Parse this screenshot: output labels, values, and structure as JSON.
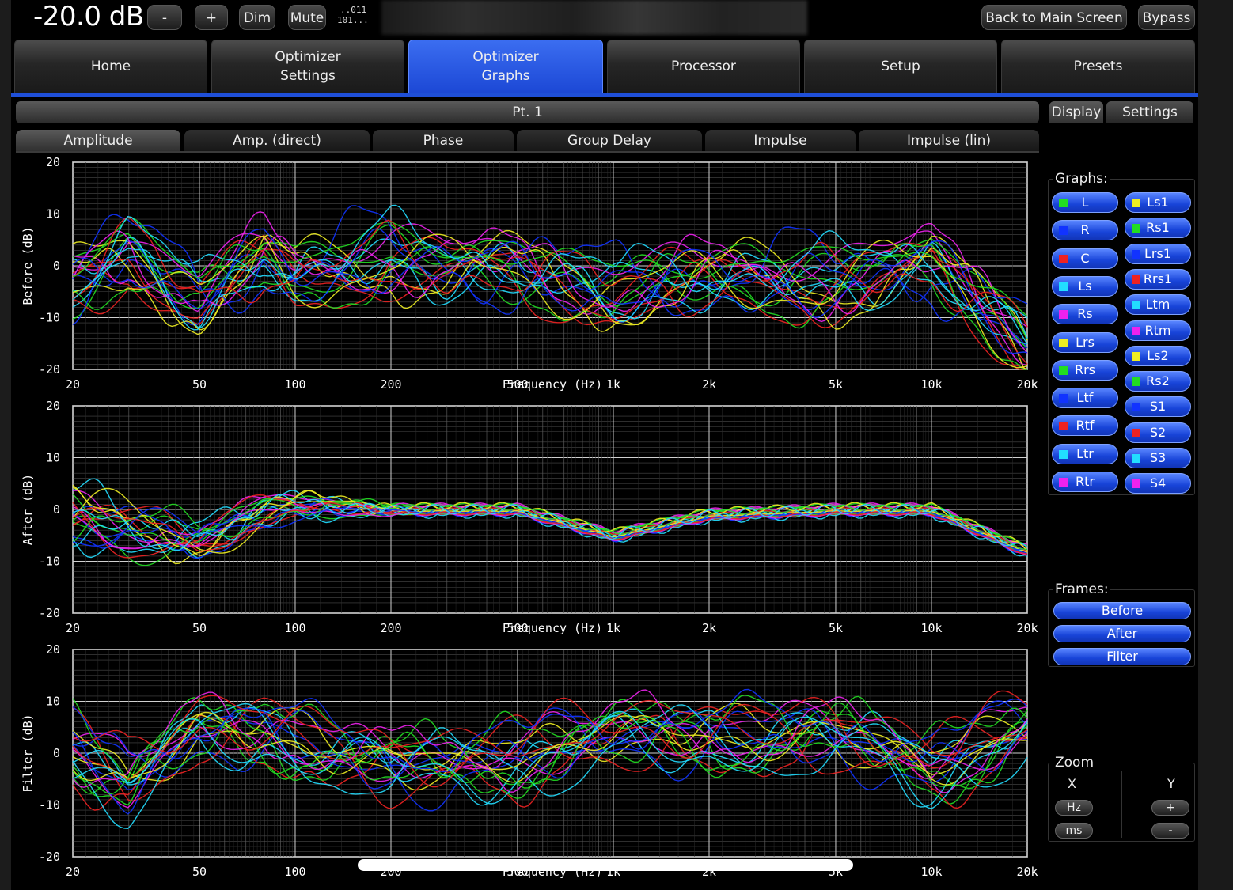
{
  "header": {
    "volume": "-20.0 dB",
    "minus_label": "-",
    "plus_label": "+",
    "dim_label": "Dim",
    "mute_label": "Mute",
    "meter_line1": "..011",
    "meter_line2": "101...",
    "back_label": "Back to Main Screen",
    "bypass_label": "Bypass"
  },
  "nav": {
    "home": "Home",
    "opt_settings_1": "Optimizer",
    "opt_settings_2": "Settings",
    "opt_graphs_1": "Optimizer",
    "opt_graphs_2": "Graphs",
    "processor": "Processor",
    "setup": "Setup",
    "presets": "Presets"
  },
  "point_label": "Pt. 1",
  "subtabs": [
    "Amplitude",
    "Amp. (direct)",
    "Phase",
    "Group Delay",
    "Impulse",
    "Impulse (lin)"
  ],
  "side_tabs": {
    "display": "Display",
    "settings": "Settings"
  },
  "graphs_panel": {
    "title": "Graphs:",
    "channels": [
      {
        "label": "L",
        "color": "#22dd22"
      },
      {
        "label": "R",
        "color": "#1133ff"
      },
      {
        "label": "C",
        "color": "#ee2222"
      },
      {
        "label": "Ls",
        "color": "#22ddff"
      },
      {
        "label": "Rs",
        "color": "#ee22ee"
      },
      {
        "label": "Lrs",
        "color": "#eeee22"
      },
      {
        "label": "Rrs",
        "color": "#22dd22"
      },
      {
        "label": "Ltf",
        "color": "#1133ff"
      },
      {
        "label": "Rtf",
        "color": "#ee2222"
      },
      {
        "label": "Ltr",
        "color": "#22ddff"
      },
      {
        "label": "Rtr",
        "color": "#ee22ee"
      },
      {
        "label": "Ls1",
        "color": "#eeee22"
      },
      {
        "label": "Rs1",
        "color": "#22dd22"
      },
      {
        "label": "Lrs1",
        "color": "#1133ff"
      },
      {
        "label": "Rrs1",
        "color": "#ee2222"
      },
      {
        "label": "Ltm",
        "color": "#22ddff"
      },
      {
        "label": "Rtm",
        "color": "#ee22ee"
      },
      {
        "label": "Ls2",
        "color": "#eeee22"
      },
      {
        "label": "Rs2",
        "color": "#22dd22"
      },
      {
        "label": "S1",
        "color": "#1133ff"
      },
      {
        "label": "S2",
        "color": "#ee2222"
      },
      {
        "label": "S3",
        "color": "#22ddff"
      },
      {
        "label": "S4",
        "color": "#ee22ee"
      }
    ]
  },
  "frames_panel": {
    "title": "Frames:",
    "before": "Before",
    "after": "After",
    "filter": "Filter"
  },
  "zoom_panel": {
    "title": "Zoom",
    "x_label": "X",
    "y_label": "Y",
    "hz": "Hz",
    "ms": "ms",
    "plus": "+",
    "minus": "-"
  },
  "chart_data": [
    {
      "type": "line",
      "ylabel": "Before (dB)",
      "xlabel": "Frequency (Hz)",
      "x_scale": "log",
      "xlim": [
        20,
        20000
      ],
      "ylim": [
        -20,
        20
      ],
      "x_ticks": [
        "20",
        "50",
        "100",
        "200",
        "500",
        "1k",
        "2k",
        "5k",
        "10k",
        "20k"
      ],
      "y_ticks": [
        "20",
        "10",
        "0",
        "-10",
        "-20"
      ],
      "grid": true,
      "series_colors": [
        "#22dd22",
        "#1133ff",
        "#ee2222",
        "#22ddff",
        "#ee22ee",
        "#eeee22"
      ],
      "approx_trend": {
        "x": [
          20,
          30,
          50,
          80,
          100,
          200,
          300,
          500,
          1000,
          2000,
          5000,
          10000,
          20000
        ],
        "y": [
          -3,
          4,
          -6,
          2,
          -2,
          3,
          0,
          0,
          -4,
          -2,
          -2,
          1,
          -14
        ]
      }
    },
    {
      "type": "line",
      "ylabel": "After (dB)",
      "xlabel": "Frequency (Hz)",
      "x_scale": "log",
      "xlim": [
        20,
        20000
      ],
      "ylim": [
        -20,
        20
      ],
      "x_ticks": [
        "20",
        "50",
        "100",
        "200",
        "500",
        "1k",
        "2k",
        "5k",
        "10k",
        "20k"
      ],
      "y_ticks": [
        "20",
        "10",
        "0",
        "-10",
        "-20"
      ],
      "grid": true,
      "series_colors": [
        "#22dd22",
        "#1133ff",
        "#ee2222",
        "#22ddff",
        "#ee22ee",
        "#eeee22"
      ],
      "approx_trend": {
        "x": [
          20,
          30,
          50,
          80,
          100,
          200,
          300,
          500,
          1000,
          2000,
          5000,
          10000,
          20000
        ],
        "y": [
          -1,
          -4,
          -6,
          0,
          1,
          0,
          0,
          0,
          -5,
          -1,
          0,
          0,
          -8
        ]
      }
    },
    {
      "type": "line",
      "ylabel": "Filter (dB)",
      "xlabel": "Frequency (Hz)",
      "x_scale": "log",
      "xlim": [
        20,
        20000
      ],
      "ylim": [
        -20,
        20
      ],
      "x_ticks": [
        "20",
        "50",
        "100",
        "200",
        "500",
        "1k",
        "2k",
        "5k",
        "10k",
        "20k"
      ],
      "y_ticks": [
        "20",
        "10",
        "0",
        "-10",
        "-20"
      ],
      "grid": true,
      "series_colors": [
        "#22dd22",
        "#1133ff",
        "#ee2222",
        "#22ddff",
        "#ee22ee",
        "#eeee22"
      ],
      "approx_trend": {
        "x": [
          20,
          30,
          50,
          80,
          100,
          200,
          300,
          500,
          1000,
          2000,
          5000,
          10000,
          20000
        ],
        "y": [
          2,
          -6,
          4,
          5,
          3,
          -3,
          -2,
          0,
          3,
          4,
          3,
          -2,
          5
        ]
      }
    }
  ]
}
